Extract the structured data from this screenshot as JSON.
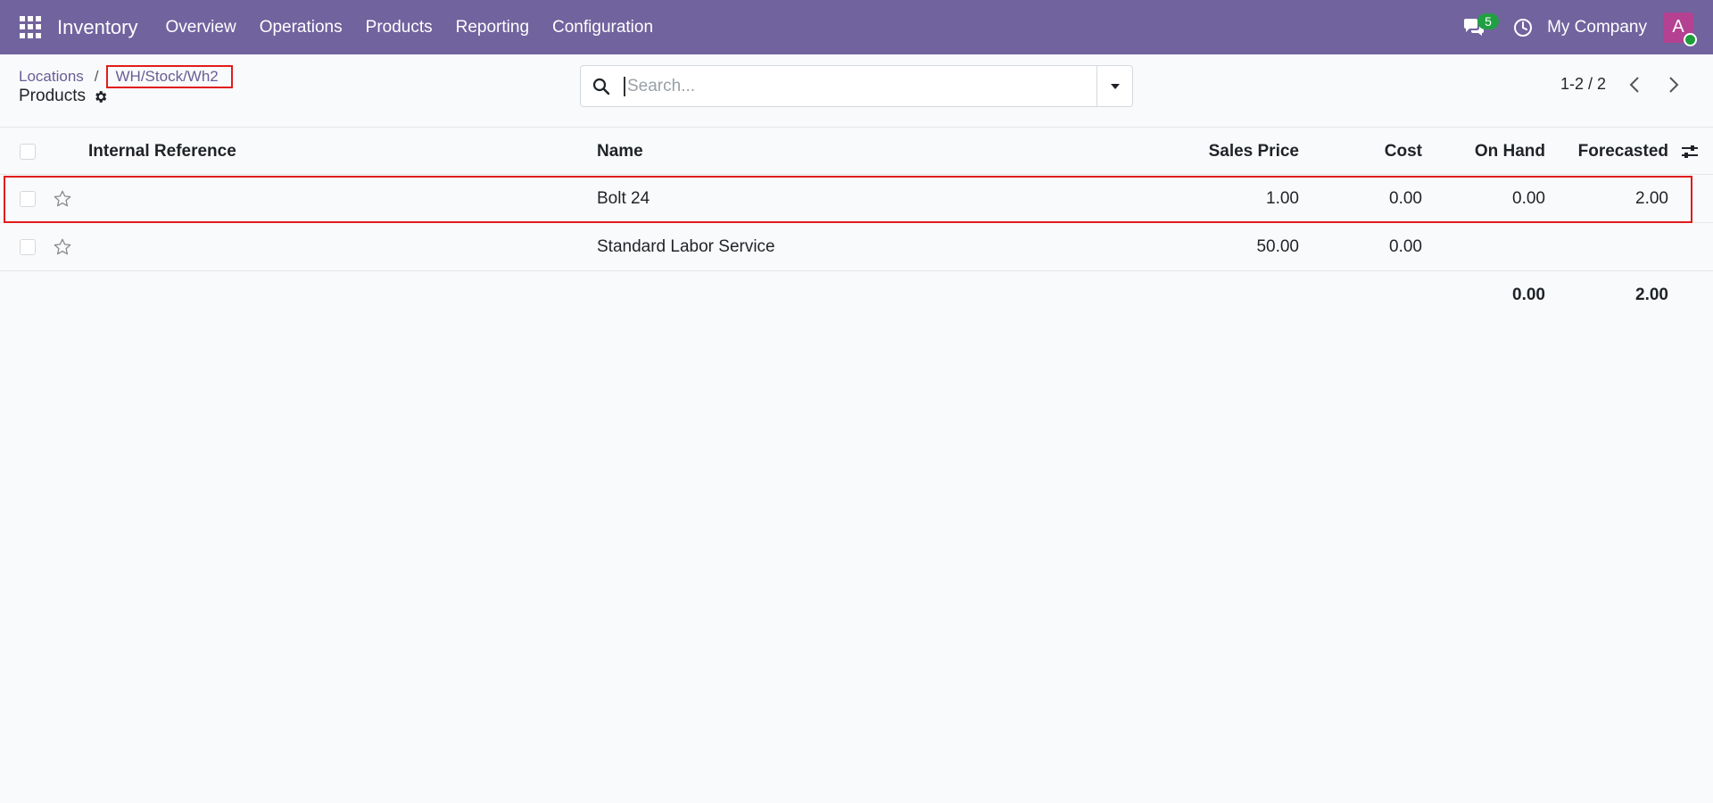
{
  "navbar": {
    "app_title": "Inventory",
    "menu": [
      "Overview",
      "Operations",
      "Products",
      "Reporting",
      "Configuration"
    ],
    "messages_count": "5",
    "company": "My Company",
    "avatar_initial": "A",
    "brand_color": "#71639e",
    "icons": [
      "apps-grid-icon",
      "chat-icon",
      "clock-icon"
    ]
  },
  "breadcrumb": {
    "parent": "Locations",
    "separator": "/",
    "current": "WH/Stock/Wh2"
  },
  "page": {
    "title": "Products",
    "settings_icon": "gear-icon"
  },
  "search": {
    "placeholder": "Search...",
    "value": ""
  },
  "pager": {
    "text": "1-2 / 2"
  },
  "table": {
    "columns": [
      "Internal Reference",
      "Name",
      "Sales Price",
      "Cost",
      "On Hand",
      "Forecasted"
    ],
    "rows": [
      {
        "internal_reference": "",
        "name": "Bolt 24",
        "sales_price": "1.00",
        "cost": "0.00",
        "on_hand": "0.00",
        "forecasted": "2.00",
        "highlighted": true
      },
      {
        "internal_reference": "",
        "name": "Standard Labor Service",
        "sales_price": "50.00",
        "cost": "0.00",
        "on_hand": "",
        "forecasted": "",
        "highlighted": false
      }
    ],
    "totals": {
      "on_hand": "0.00",
      "forecasted": "2.00"
    }
  },
  "colors": {
    "highlight": "#e11c1c",
    "link": "#6a5d96",
    "badge": "#21a043",
    "avatar": "#b44192"
  }
}
